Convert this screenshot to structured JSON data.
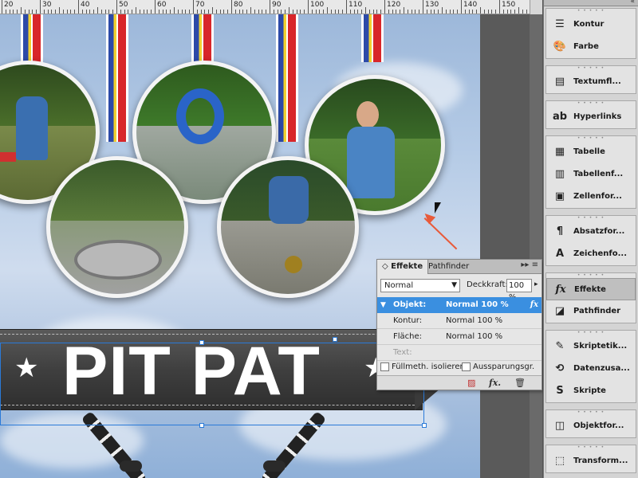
{
  "ruler": {
    "labels": [
      "20",
      "30",
      "40",
      "50",
      "60",
      "70",
      "80",
      "90",
      "100",
      "110",
      "120",
      "130",
      "140",
      "150"
    ]
  },
  "banner": {
    "title": "PIT PAT",
    "star_left": "★",
    "star_right": "★"
  },
  "effekte_panel": {
    "tab_active": "Effekte",
    "tab_other": "Pathfinder",
    "menu_icon": "panel-menu-icon",
    "blend_mode": "Normal",
    "opacity_label": "Deckkraft:",
    "opacity_value": "100 %",
    "rows": {
      "objekt_label": "Objekt:",
      "objekt_value": "Normal 100 %",
      "objekt_fx": "fx",
      "kontur_label": "Kontur:",
      "kontur_value": "Normal 100 %",
      "flaeche_label": "Fläche:",
      "flaeche_value": "Normal 100 %",
      "text_label": "Text:"
    },
    "checkbox_isolate": "Füllmeth. isolieren",
    "checkbox_knockout": "Aussparungsgr.",
    "footer": {
      "clear_icon": "clear-effects-icon",
      "fx_icon": "fx-icon",
      "trash_icon": "trash-icon"
    }
  },
  "right_panel": {
    "groups": [
      {
        "items": [
          {
            "label": "Kontur",
            "icon": "stroke-icon"
          },
          {
            "label": "Farbe",
            "icon": "palette-icon"
          }
        ]
      },
      {
        "items": [
          {
            "label": "Textumfl...",
            "icon": "text-wrap-icon"
          }
        ]
      },
      {
        "items": [
          {
            "label": "Hyperlinks",
            "icon": "hyperlink-icon"
          }
        ]
      },
      {
        "items": [
          {
            "label": "Tabelle",
            "icon": "table-icon"
          },
          {
            "label": "Tabellenf...",
            "icon": "table-format-icon"
          },
          {
            "label": "Zellenfor...",
            "icon": "cell-format-icon"
          }
        ]
      },
      {
        "items": [
          {
            "label": "Absatzfor...",
            "icon": "paragraph-style-icon"
          },
          {
            "label": "Zeichenfo...",
            "icon": "character-style-icon"
          }
        ]
      },
      {
        "items": [
          {
            "label": "Effekte",
            "icon": "fx-icon",
            "active": true
          },
          {
            "label": "Pathfinder",
            "icon": "pathfinder-icon"
          }
        ]
      },
      {
        "items": [
          {
            "label": "Skriptetik...",
            "icon": "script-label-icon"
          },
          {
            "label": "Datenzusa...",
            "icon": "data-merge-icon"
          },
          {
            "label": "Skripte",
            "icon": "scripts-icon"
          }
        ]
      },
      {
        "items": [
          {
            "label": "Objektfor...",
            "icon": "object-style-icon"
          }
        ]
      },
      {
        "items": [
          {
            "label": "Transform...",
            "icon": "transform-icon"
          }
        ]
      }
    ]
  },
  "colors": {
    "selection_blue": "#3a8fe0",
    "annotation_arrow": "#e85a3a",
    "banner_gray": "#3f3f3f"
  }
}
